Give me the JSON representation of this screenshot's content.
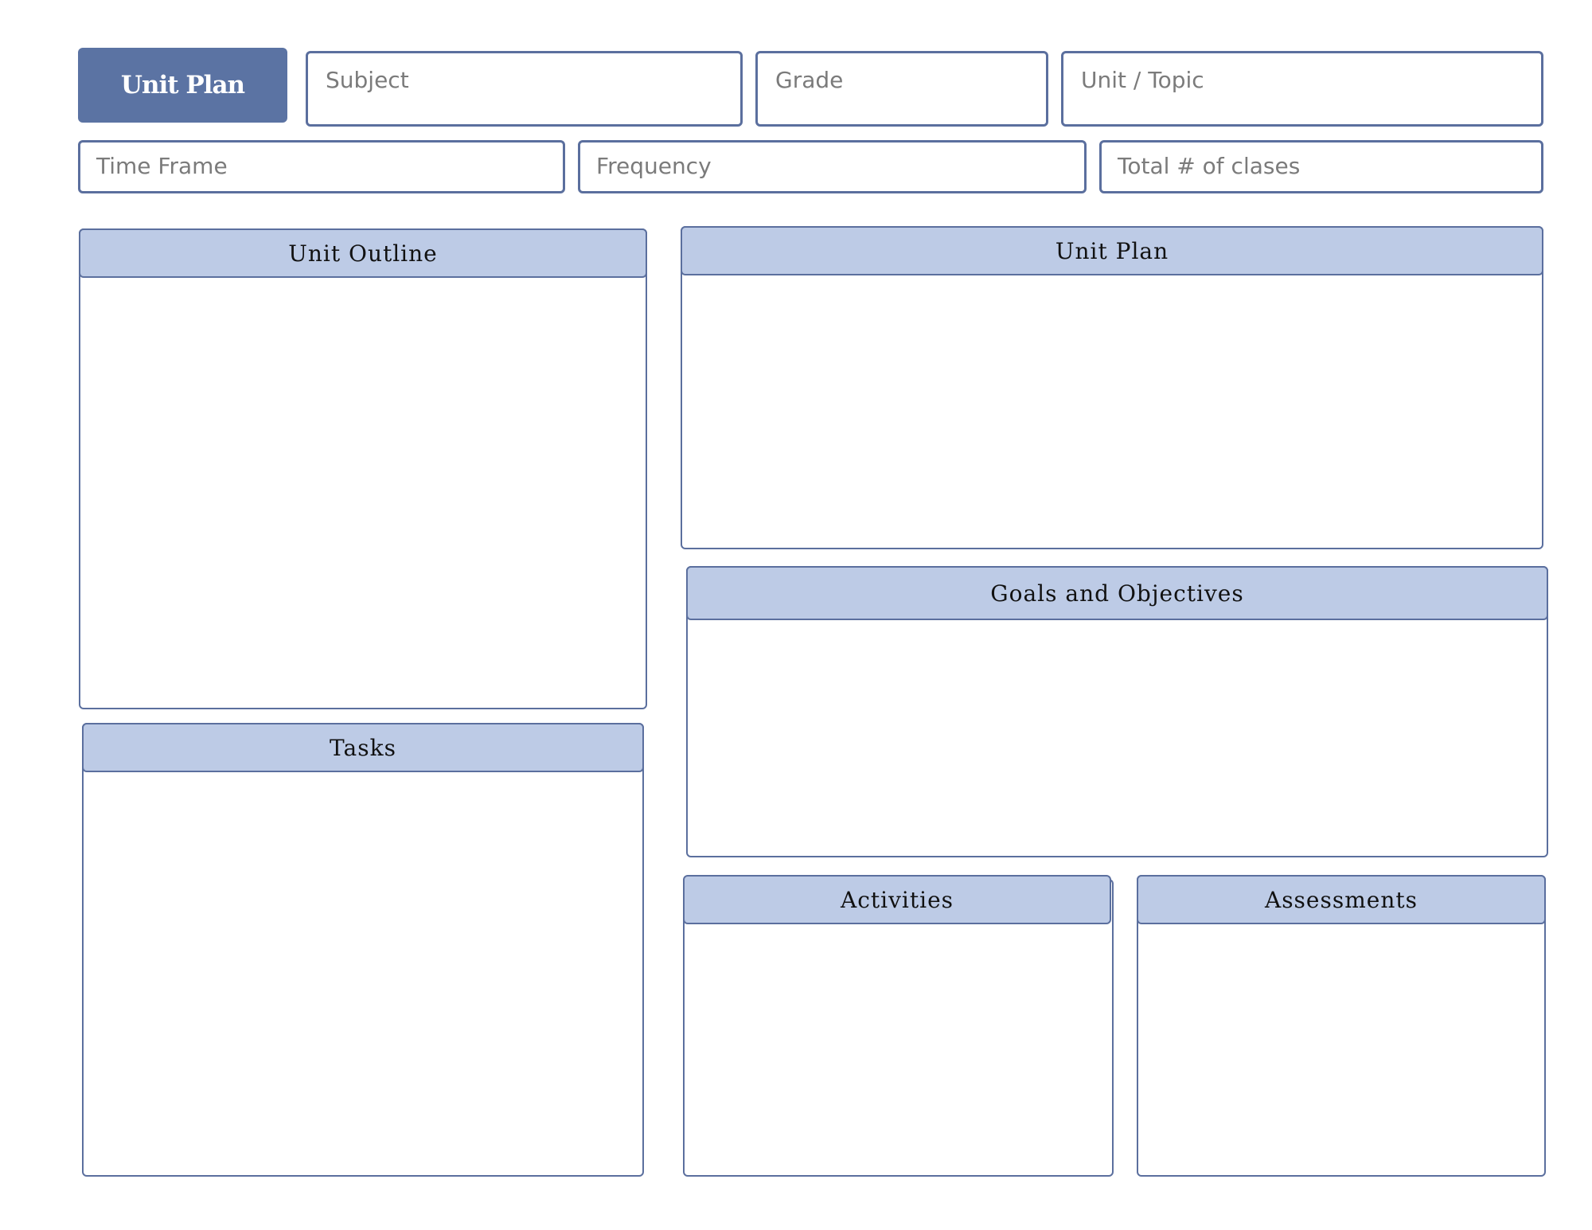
{
  "header": {
    "title": "Unit Plan",
    "fields": {
      "subject": "Subject",
      "grade": "Grade",
      "unit_topic": "Unit / Topic",
      "time_frame": "Time Frame",
      "frequency": "Frequency",
      "total_classes": "Total # of clases"
    }
  },
  "sections": {
    "unit_outline": "Unit Outline",
    "unit_plan": "Unit Plan",
    "goals_objectives": "Goals and Objectives",
    "tasks": "Tasks",
    "activities": "Activities",
    "assessments": "Assessments"
  },
  "colors": {
    "title_fill": "#5b73a3",
    "border": "#5b6f9e",
    "header_fill": "#bdcbe6"
  }
}
